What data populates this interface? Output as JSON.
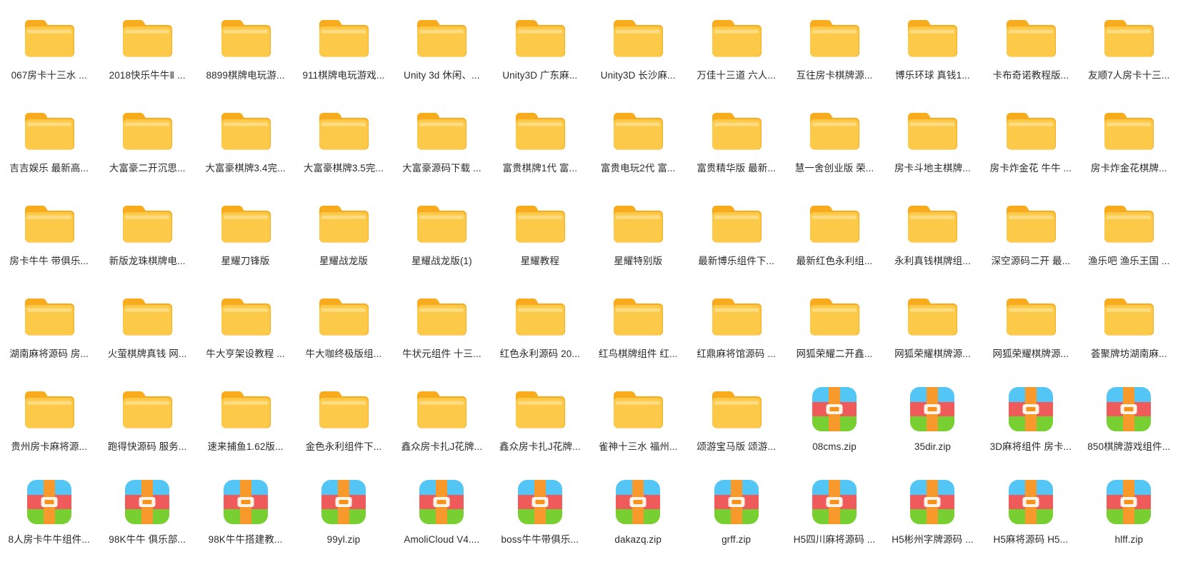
{
  "window": {
    "view_mode": "icon-grid",
    "columns": 12,
    "rows": 6,
    "background_color": "#ffffff",
    "label_color": "#2b2b2b"
  },
  "icons": {
    "folder": {
      "name": "folder-icon",
      "body_color": "#fcc84e",
      "tab_color": "#f9a825",
      "highlight_color": "#fde089"
    },
    "zip": {
      "name": "zip-archive-icon",
      "top_color": "#4fc3f7",
      "middle_color": "#ef5350",
      "bottom_color": "#7ed321",
      "strap_color": "#f79a2b",
      "buckle_color": "#fdf3e6"
    }
  },
  "files": [
    {
      "name": "067房卡十三水 ...",
      "type": "folder"
    },
    {
      "name": "2018快乐牛牛Ⅱ ...",
      "type": "folder"
    },
    {
      "name": "8899棋牌电玩游...",
      "type": "folder"
    },
    {
      "name": "911棋牌电玩游戏...",
      "type": "folder"
    },
    {
      "name": "Unity 3d 休闲、...",
      "type": "folder"
    },
    {
      "name": "Unity3D 广东麻...",
      "type": "folder"
    },
    {
      "name": "Unity3D 长沙麻...",
      "type": "folder"
    },
    {
      "name": "万佳十三道 六人...",
      "type": "folder"
    },
    {
      "name": "互往房卡棋牌源...",
      "type": "folder"
    },
    {
      "name": "博乐环球 真钱1...",
      "type": "folder"
    },
    {
      "name": "卡布奇诺教程版...",
      "type": "folder"
    },
    {
      "name": "友顺7人房卡十三...",
      "type": "folder"
    },
    {
      "name": "吉吉娱乐 最新高...",
      "type": "folder"
    },
    {
      "name": "大富豪二开沉思...",
      "type": "folder"
    },
    {
      "name": "大富豪棋牌3.4完...",
      "type": "folder"
    },
    {
      "name": "大富豪棋牌3.5完...",
      "type": "folder"
    },
    {
      "name": "大富豪源码下载 ...",
      "type": "folder"
    },
    {
      "name": "富贵棋牌1代 富...",
      "type": "folder"
    },
    {
      "name": "富贵电玩2代 富...",
      "type": "folder"
    },
    {
      "name": "富贵精华版 最新...",
      "type": "folder"
    },
    {
      "name": "慧一舍创业版 荣...",
      "type": "folder"
    },
    {
      "name": "房卡斗地主棋牌...",
      "type": "folder"
    },
    {
      "name": "房卡炸金花 牛牛 ...",
      "type": "folder"
    },
    {
      "name": "房卡炸金花棋牌...",
      "type": "folder"
    },
    {
      "name": "房卡牛牛 带俱乐...",
      "type": "folder"
    },
    {
      "name": "新版龙珠棋牌电...",
      "type": "folder"
    },
    {
      "name": "星耀刀锋版",
      "type": "folder"
    },
    {
      "name": "星耀战龙版",
      "type": "folder"
    },
    {
      "name": "星耀战龙版(1)",
      "type": "folder"
    },
    {
      "name": "星耀教程",
      "type": "folder"
    },
    {
      "name": "星耀特别版",
      "type": "folder"
    },
    {
      "name": "最新博乐组件下...",
      "type": "folder"
    },
    {
      "name": "最新红色永利组...",
      "type": "folder"
    },
    {
      "name": "永利真钱棋牌组...",
      "type": "folder"
    },
    {
      "name": "深空源码二开 最...",
      "type": "folder"
    },
    {
      "name": "渔乐吧 渔乐王国 ...",
      "type": "folder"
    },
    {
      "name": "湖南麻将源码 房...",
      "type": "folder"
    },
    {
      "name": "火萤棋牌真钱 网...",
      "type": "folder"
    },
    {
      "name": "牛大亨架设教程 ...",
      "type": "folder"
    },
    {
      "name": "牛大咖终极版组...",
      "type": "folder"
    },
    {
      "name": "牛状元组件 十三...",
      "type": "folder"
    },
    {
      "name": "红色永利源码 20...",
      "type": "folder"
    },
    {
      "name": "红鸟棋牌组件 红...",
      "type": "folder"
    },
    {
      "name": "红鼎麻将馆源码 ...",
      "type": "folder"
    },
    {
      "name": "网狐荣耀二开鑫...",
      "type": "folder"
    },
    {
      "name": "网狐荣耀棋牌源...",
      "type": "folder"
    },
    {
      "name": "网狐荣耀棋牌源...",
      "type": "folder"
    },
    {
      "name": "荟聚牌坊湖南麻...",
      "type": "folder"
    },
    {
      "name": "贵州房卡麻将源...",
      "type": "folder"
    },
    {
      "name": "跑得快源码 服务...",
      "type": "folder"
    },
    {
      "name": "速来捕鱼1.62版...",
      "type": "folder"
    },
    {
      "name": "金色永利组件下...",
      "type": "folder"
    },
    {
      "name": "鑫众房卡扎J花牌...",
      "type": "folder"
    },
    {
      "name": "鑫众房卡扎J花牌...",
      "type": "folder"
    },
    {
      "name": "雀神十三水 福州...",
      "type": "folder"
    },
    {
      "name": "颂游宝马版 颂游...",
      "type": "folder"
    },
    {
      "name": "08cms.zip",
      "type": "zip"
    },
    {
      "name": "35dir.zip",
      "type": "zip"
    },
    {
      "name": "3D麻将组件 房卡...",
      "type": "zip"
    },
    {
      "name": "850棋牌游戏组件...",
      "type": "zip"
    },
    {
      "name": "8人房卡牛牛组件...",
      "type": "zip"
    },
    {
      "name": "98K牛牛 俱乐部...",
      "type": "zip"
    },
    {
      "name": "98K牛牛搭建教...",
      "type": "zip"
    },
    {
      "name": "99yl.zip",
      "type": "zip"
    },
    {
      "name": "AmoliCloud V4....",
      "type": "zip"
    },
    {
      "name": "boss牛牛带俱乐...",
      "type": "zip"
    },
    {
      "name": "dakazq.zip",
      "type": "zip"
    },
    {
      "name": "grff.zip",
      "type": "zip"
    },
    {
      "name": "H5四川麻将源码 ...",
      "type": "zip"
    },
    {
      "name": "H5彬州字牌源码 ...",
      "type": "zip"
    },
    {
      "name": "H5麻将源码 H5...",
      "type": "zip"
    },
    {
      "name": "hlff.zip",
      "type": "zip"
    }
  ]
}
